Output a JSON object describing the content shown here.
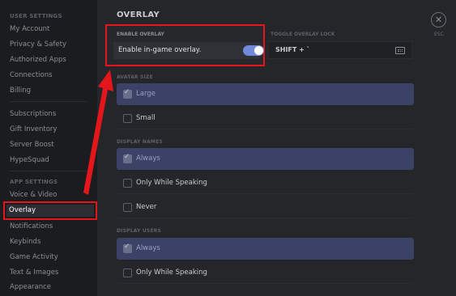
{
  "sidebar": {
    "user_settings_header": "USER SETTINGS",
    "user_items": [
      "My Account",
      "Privacy & Safety",
      "Authorized Apps",
      "Connections",
      "Billing"
    ],
    "nitro_items": [
      "Subscriptions",
      "Gift Inventory",
      "Server Boost",
      "HypeSquad"
    ],
    "app_settings_header": "APP SETTINGS",
    "app_items": [
      "Voice & Video",
      "Overlay",
      "Notifications",
      "Keybinds",
      "Game Activity",
      "Text & Images",
      "Appearance"
    ]
  },
  "page": {
    "title": "OVERLAY",
    "close_label": "ESC"
  },
  "enable_overlay": {
    "header": "ENABLE OVERLAY",
    "label": "Enable in-game overlay.",
    "enabled": true
  },
  "toggle_lock": {
    "header": "TOGGLE OVERLAY LOCK",
    "keybind": "SHIFT + `"
  },
  "avatar_size": {
    "header": "AVATAR SIZE",
    "options": [
      "Large",
      "Small"
    ],
    "selected": "Large"
  },
  "display_names": {
    "header": "DISPLAY NAMES",
    "options": [
      "Always",
      "Only While Speaking",
      "Never"
    ],
    "selected": "Always"
  },
  "display_users": {
    "header": "DISPLAY USERS",
    "options": [
      "Always",
      "Only While Speaking"
    ],
    "selected": "Always"
  },
  "colors": {
    "highlight": "#e4161b",
    "toggle_on": "#7289da",
    "selected_row": "#3c4266"
  },
  "annotation": {
    "arrow": "red-arrow"
  }
}
